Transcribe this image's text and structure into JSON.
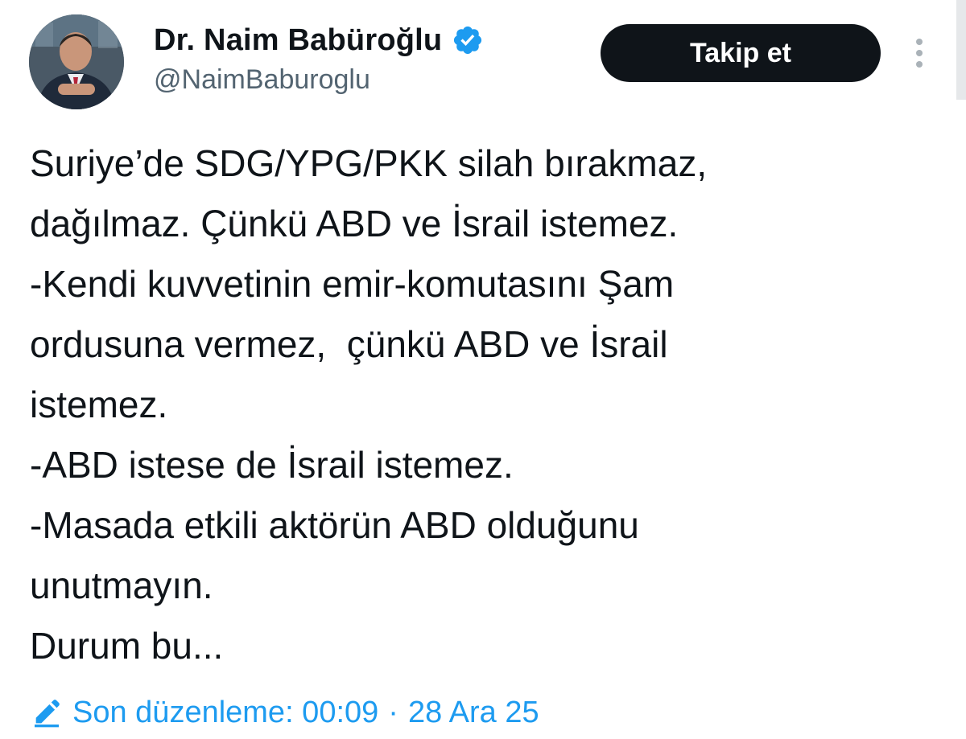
{
  "author": {
    "display_name": "Dr. Naim Babüroğlu",
    "handle": "@NaimBaburoglu",
    "verified_icon": "verified-badge-icon",
    "verified_color": "#1d9bf0"
  },
  "actions": {
    "follow_label": "Takip et",
    "more_icon": "more-vertical-icon"
  },
  "tweet": {
    "lines": [
      "Suriye’de SDG/YPG/PKK silah bırakmaz,",
      "dağılmaz. Çünkü ABD ve İsrail istemez.",
      "-Kendi kuvvetinin emir-komutasını Şam",
      "ordusuna vermez,  çünkü ABD ve İsrail",
      "istemez.",
      "-ABD istese de İsrail istemez.",
      "-Masada etkili aktörün ABD olduğunu",
      "unutmayın.",
      "Durum bu..."
    ]
  },
  "meta": {
    "edited_icon": "pencil-icon",
    "edited_label": "Son düzenleme: 00:09",
    "separator": "·",
    "date": "28 Ara 25",
    "link_color": "#1d9bf0"
  },
  "colors": {
    "text": "#0f1419",
    "secondary_text": "#536471",
    "button_bg": "#0f1419",
    "button_text": "#ffffff"
  }
}
